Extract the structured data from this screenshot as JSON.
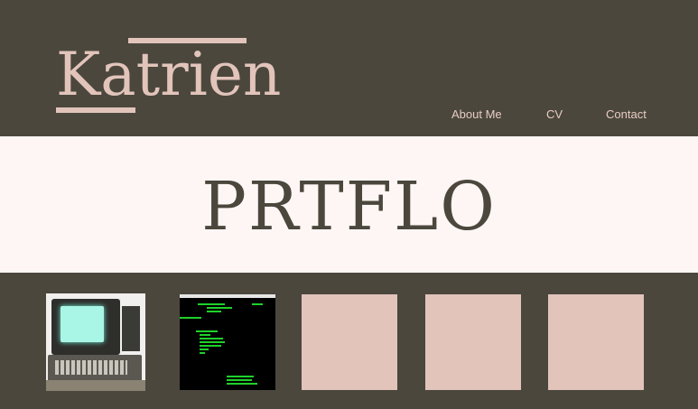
{
  "header": {
    "logo_text": "Katrien",
    "nav": {
      "about": "About Me",
      "cv": "CV",
      "contact": "Contact"
    }
  },
  "hero": {
    "title": "PRTFLO"
  },
  "gallery": {
    "items": [
      {
        "icon": "vintage-computer-photo"
      },
      {
        "icon": "terminal-screenshot"
      },
      {
        "icon": "placeholder"
      },
      {
        "icon": "placeholder"
      },
      {
        "icon": "placeholder"
      }
    ]
  },
  "colors": {
    "background": "#4b473d",
    "accent": "#e2c4bb",
    "hero_bg": "#fdf6f4"
  }
}
